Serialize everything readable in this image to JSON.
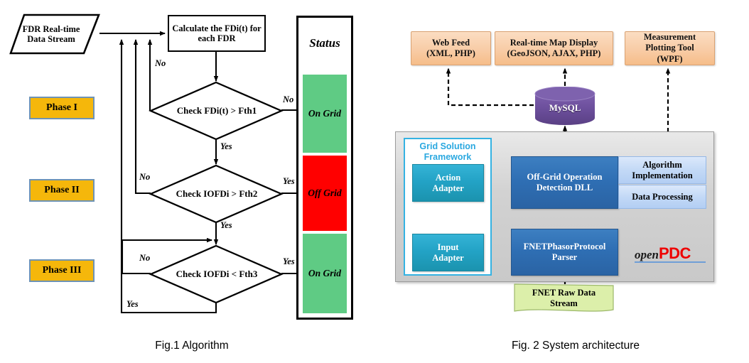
{
  "figure1": {
    "caption": "Fig.1 Algorithm",
    "input_node": "FDR Real-time Data Stream",
    "process_box": "Calculate the FDi(t) for each FDR",
    "phases": [
      {
        "label": "Phase I"
      },
      {
        "label": "Phase II"
      },
      {
        "label": "Phase III"
      }
    ],
    "decisions": [
      {
        "label": "Check FDi(t) > Fth1",
        "yes_label": "Yes",
        "no_label": "No",
        "right_branch": "No",
        "down_branch": "Yes",
        "left_branch": "No"
      },
      {
        "label": "Check IOFDi > Fth2",
        "yes_label": "Yes",
        "no_label": "No",
        "right_branch": "Yes",
        "down_branch": "Yes",
        "left_branch": "No"
      },
      {
        "label": "Check IOFDi < Fth3",
        "yes_label": "Yes",
        "no_label": "No",
        "right_branch": "Yes",
        "down_branch": "Yes",
        "left_branch": "No"
      }
    ],
    "status_panel": {
      "title": "Status",
      "cells": [
        {
          "label": "On Grid",
          "color": "#5FCB84"
        },
        {
          "label": "Off Grid",
          "color": "#FF0000"
        },
        {
          "label": "On Grid",
          "color": "#5FCB84"
        }
      ]
    },
    "branch_labels": {
      "loop_no_1": "No",
      "loop_no_2": "No",
      "loop_yes_bottom": "Yes",
      "d1_right": "No",
      "d1_down": "Yes",
      "d2_left": "No",
      "d2_right": "Yes",
      "d2_down": "Yes",
      "d3_left": "No",
      "d3_right": "Yes"
    },
    "colors": {
      "phase_fill": "#F5B70B",
      "phase_border": "#6E93B5",
      "on_grid": "#5FCB84",
      "off_grid": "#FF0000"
    }
  },
  "figure2": {
    "caption": "Fig. 2 System architecture",
    "top_boxes": [
      {
        "line1": "Web Feed",
        "line2": "(XML, PHP)"
      },
      {
        "line1": "Real-time Map Display",
        "line2": "(GeoJSON, AJAX, PHP)"
      },
      {
        "line1": "Measurement",
        "line2": "Plotting Tool",
        "line3": "(WPF)"
      }
    ],
    "database": {
      "label": "MySQL",
      "color": "#6B4E9B"
    },
    "framework_panel": {
      "title_line1": "Grid Solution",
      "title_line2": "Framework",
      "adapters": [
        {
          "line1": "Action",
          "line2": "Adapter"
        },
        {
          "line1": "Input",
          "line2": "Adapter"
        }
      ]
    },
    "modules": [
      {
        "line1": "Off-Grid Operation",
        "line2": "Detection DLL"
      },
      {
        "line1": "FNETPhasorProtocol",
        "line2": "Parser"
      }
    ],
    "side_modules": [
      {
        "line1": "Algorithm",
        "line2": "Implementation"
      },
      {
        "line1": "Data Processing",
        "line2": ""
      }
    ],
    "logo": {
      "prefix": "open",
      "suffix": "PDC"
    },
    "source": {
      "line1": "FNET Raw Data",
      "line2": "Stream"
    },
    "colors": {
      "orange": "#F7C79E",
      "teal": "#23A3C6",
      "blue": "#2F6FB4",
      "light_blue": "#C3D9F6",
      "green": "#D9EDA6",
      "purple": "#6B4E9B",
      "panel_gray": "#D2D2D2",
      "accent_cyan": "#2AA8E0",
      "logo_red": "#EE0000"
    }
  }
}
